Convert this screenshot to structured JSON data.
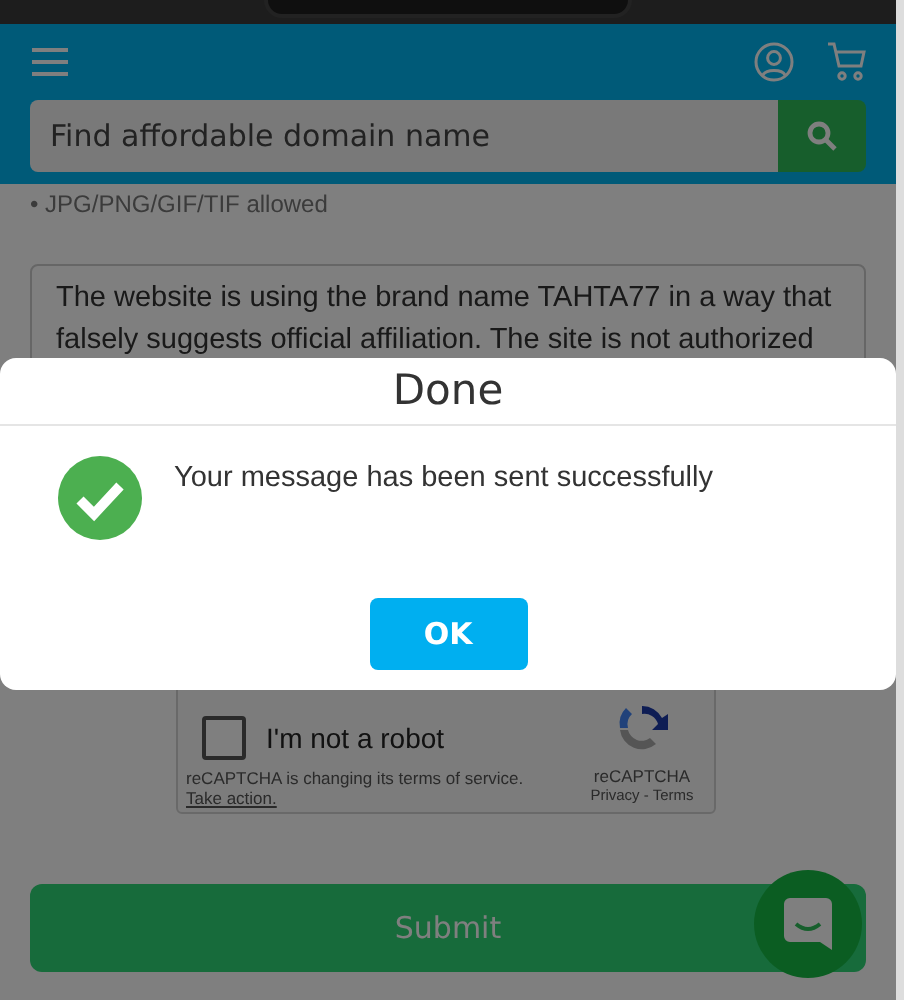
{
  "header": {
    "search": {
      "placeholder": "Find affordable domain name"
    }
  },
  "upload_hint": "• JPG/PNG/GIF/TIF allowed",
  "message_field": {
    "lines": [
      "The website is using the brand name TAHTA77 in a way that",
      "falsely suggests official affiliation. The site is not authorized"
    ]
  },
  "captcha": {
    "checked": false,
    "label": "I'm not a robot",
    "notice": "reCAPTCHA is changing its terms of service.",
    "link": "Take action.",
    "brand": "reCAPTCHA",
    "links": "Privacy - Terms"
  },
  "submit_button": "Submit",
  "dialog": {
    "title": "Done",
    "message": "Your message has been sent successfully",
    "button": "OK"
  }
}
